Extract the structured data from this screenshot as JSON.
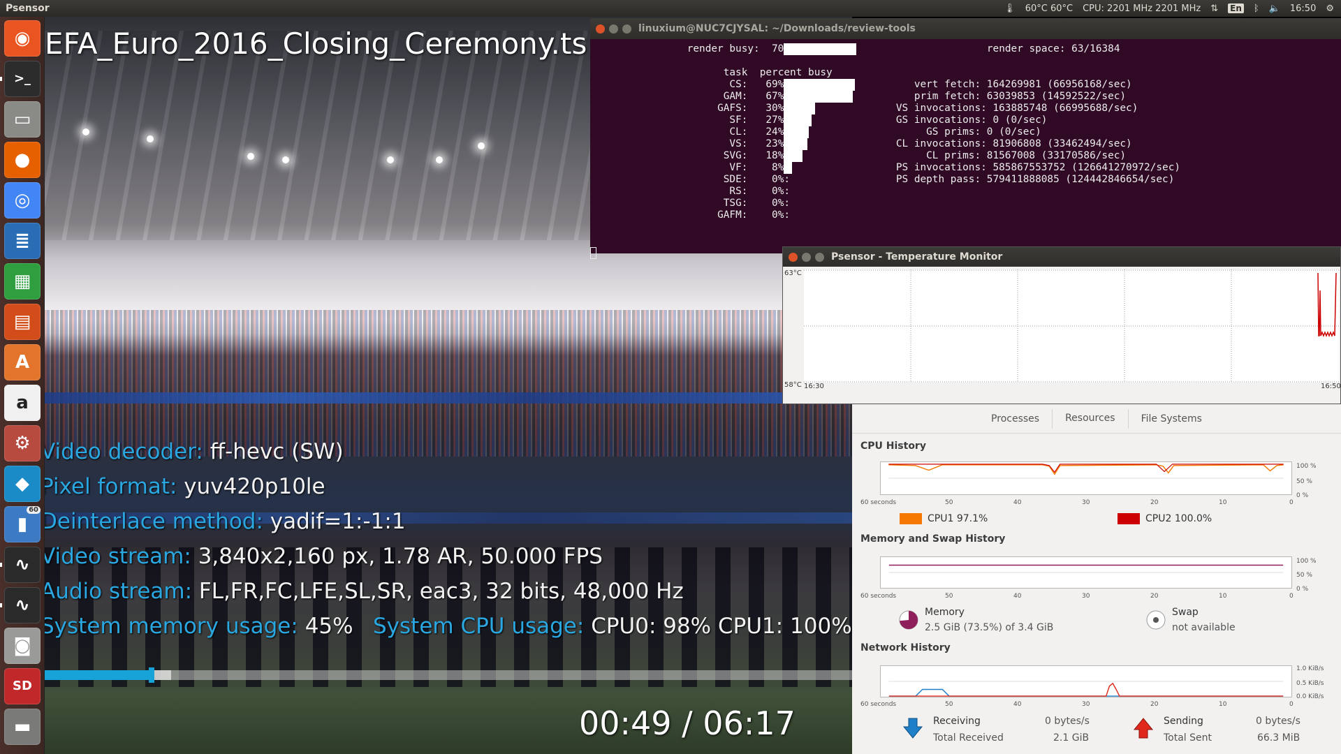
{
  "top_panel": {
    "app_name": "Psensor",
    "temperature": "60°C 60°C",
    "cpu": "CPU: 2201 MHz 2201 MHz",
    "keyboard_layout": "En",
    "clock": "16:50"
  },
  "launcher": {
    "items": [
      {
        "name": "ubuntu-dash-icon",
        "glyph": "◉",
        "color": "#e95420"
      },
      {
        "name": "terminal-icon",
        "glyph": ">_",
        "color": "#2c2c2c"
      },
      {
        "name": "files-icon",
        "glyph": "▭",
        "color": "#8a8a86"
      },
      {
        "name": "firefox-icon",
        "glyph": "●",
        "color": "#e66000"
      },
      {
        "name": "chrome-icon",
        "glyph": "◎",
        "color": "#4285f4"
      },
      {
        "name": "writer-icon",
        "glyph": "≣",
        "color": "#2a6db5"
      },
      {
        "name": "calc-icon",
        "glyph": "▦",
        "color": "#2e9e3f"
      },
      {
        "name": "impress-icon",
        "glyph": "▤",
        "color": "#d24d1a"
      },
      {
        "name": "software-center-icon",
        "glyph": "A",
        "color": "#e2742c"
      },
      {
        "name": "amazon-icon",
        "glyph": "a",
        "color": "#f0f0f0"
      },
      {
        "name": "settings-icon",
        "glyph": "⚙",
        "color": "#b84b40"
      },
      {
        "name": "kodi-icon",
        "glyph": "◆",
        "color": "#1a8bc6"
      },
      {
        "name": "benchmark-icon",
        "glyph": "▮",
        "color": "#3d7ac4",
        "badge": "60"
      },
      {
        "name": "psensor-icon",
        "glyph": "∿",
        "color": "#2a2a2a"
      },
      {
        "name": "system-monitor-icon",
        "glyph": "∿",
        "color": "#2a2a2a"
      },
      {
        "name": "camera-icon",
        "glyph": "◙",
        "color": "#9a9a98"
      },
      {
        "name": "sd-card-icon",
        "glyph": "SD",
        "color": "#c0282a"
      },
      {
        "name": "usb-drive-icon",
        "glyph": "▬",
        "color": "#7a7a78"
      }
    ]
  },
  "video": {
    "title": "EFA_Euro_2016_Closing_Ceremony.ts",
    "info_lines": [
      {
        "key": "Video decoder:",
        "value": "ff-hevc (SW)"
      },
      {
        "key": "Pixel format:",
        "value": "yuv420p10le"
      },
      {
        "key": "Deinterlace method:",
        "value": "yadif=1:-1:1"
      },
      {
        "key": "Video stream:",
        "value": "3,840x2,160 px, 1.78 AR, 50.000 FPS"
      },
      {
        "key": "Audio stream:",
        "value": "FL,FR,FC,LFE,SL,SR, eac3, 32 bits, 48,000 Hz"
      }
    ],
    "memory_key": "System memory usage:",
    "memory_value": "45%",
    "cpu_key": "System CPU usage:",
    "cpu_value": "CPU0:  98% CPU1: 100%",
    "progress": 0.1324,
    "buffered": 0.157,
    "time_readout": "00:49 / 06:17"
  },
  "terminal": {
    "title": "linuxium@NUC7CJYSAL: ~/Downloads/review-tools",
    "render_busy_label": "render busy:",
    "render_busy_pct": 70,
    "render_space": "render space: 63/16384",
    "header": "task  percent busy",
    "tasks": [
      {
        "task": "CS:",
        "pct": 69
      },
      {
        "task": "GAM:",
        "pct": 67
      },
      {
        "task": "GAFS:",
        "pct": 30
      },
      {
        "task": "SF:",
        "pct": 27
      },
      {
        "task": "CL:",
        "pct": 24
      },
      {
        "task": "VS:",
        "pct": 23
      },
      {
        "task": "SVG:",
        "pct": 18
      },
      {
        "task": "VF:",
        "pct": 8
      },
      {
        "task": "SDE:",
        "pct": 0
      },
      {
        "task": "RS:",
        "pct": 0
      },
      {
        "task": "TSG:",
        "pct": 0
      },
      {
        "task": "GAFM:",
        "pct": 0
      }
    ],
    "stats": [
      "   vert fetch: 164269981 (66956168/sec)",
      "   prim fetch: 63039853 (14592522/sec)",
      "VS invocations: 163885748 (66995688/sec)",
      "GS invocations: 0 (0/sec)",
      "     GS prims: 0 (0/sec)",
      "CL invocations: 81906808 (33462494/sec)",
      "     CL prims: 81567008 (33170586/sec)",
      "PS invocations: 585867553752 (126641270972/sec)",
      "PS depth pass: 579411888085 (124442846654/sec)"
    ]
  },
  "psensor": {
    "title": "Psensor - Temperature Monitor",
    "y_max_label": "63°C",
    "y_min_label": "58°C",
    "x_start_label": "16:30",
    "x_end_label": "16:50"
  },
  "system_monitor": {
    "tabs": [
      "Processes",
      "Resources",
      "File Systems"
    ],
    "active_tab": "Resources",
    "cpu_heading": "CPU History",
    "memory_heading": "Memory and Swap History",
    "network_heading": "Network History",
    "x_ticks": [
      "60 seconds",
      "50",
      "40",
      "30",
      "20",
      "10",
      "0"
    ],
    "pct_ticks": [
      "100 %",
      "50 %",
      "0 %"
    ],
    "net_ticks": [
      "1.0 KiB/s",
      "0.5 KiB/s",
      "0.0 KiB/s"
    ],
    "cpu1": {
      "label": "CPU1",
      "value": "97.1%",
      "color": "#f57900"
    },
    "cpu2": {
      "label": "CPU2",
      "value": "100.0%",
      "color": "#cc0000"
    },
    "memory": {
      "label": "Memory",
      "value": "2.5 GiB (73.5%) of 3.4 GiB",
      "color": "#8f1f5a"
    },
    "swap": {
      "label": "Swap",
      "value": "not available"
    },
    "receiving": {
      "label": "Receiving",
      "rate": "0 bytes/s",
      "total_label": "Total Received",
      "total": "2.1 GiB",
      "color": "#1f7fc7"
    },
    "sending": {
      "label": "Sending",
      "rate": "0 bytes/s",
      "total_label": "Total Sent",
      "total": "66.3 MiB",
      "color": "#e0281c"
    }
  }
}
